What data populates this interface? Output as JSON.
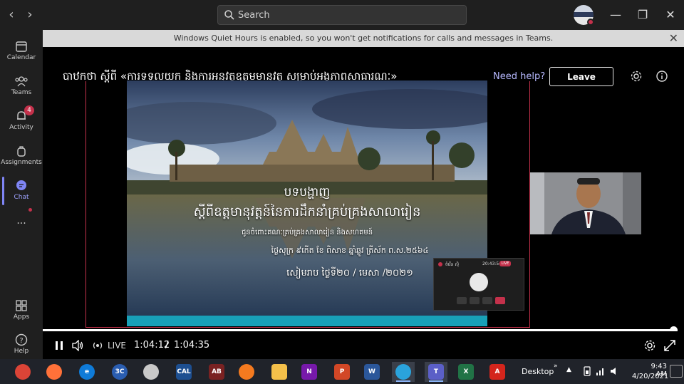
{
  "search": {
    "placeholder": "Search"
  },
  "rail": {
    "items": [
      {
        "label": "Calendar"
      },
      {
        "label": "Teams"
      },
      {
        "label": "Activity",
        "badge": "4"
      },
      {
        "label": "Assignments"
      },
      {
        "label": "Chat"
      },
      {
        "label": "..."
      },
      {
        "label": "Apps"
      },
      {
        "label": "Help"
      }
    ]
  },
  "banner": {
    "text": "Windows Quiet Hours is enabled, so you won't get notifications for calls and messages in Teams."
  },
  "meeting": {
    "title": "បាឋកថា ស្ដីពី «ការទទួលយក និងការអនុវត្តឧត្តមមានុវត្ត សម្រាប់អង្គភាពសាធារណៈ»",
    "help_label": "Need help?",
    "leave_label": "Leave"
  },
  "slide": {
    "heading": "បទបង្ហាញ",
    "subtitle": "ស្ដីពីឧត្តមានុវត្តន៍នៃការដឹកនាំគ្រប់គ្រងសាលារៀន",
    "line1": "ជូនចំពោះគណៈគ្រប់គ្រងសាលារៀន និងសហគមន៍",
    "line2": "ថ្ងៃសុក្រ ៩កើត ខែ ពិសាខ ឆ្នាំឆ្លូវ ត្រីស័ក ព.ស.២៥៦៤",
    "line3": "សៀមរាប ថ្ងៃទី២០ / មេសា /២០២១"
  },
  "mini_call": {
    "name": "ចំរើន ស៊ិ",
    "time": "20:43:54",
    "live": "LIVE"
  },
  "playback": {
    "live_label": "LIVE",
    "current_time": "1:04:12",
    "separator": "/",
    "total_time": "1:04:35",
    "progress": 0.994
  },
  "taskbar": {
    "apps": [
      {
        "name": "chrome",
        "glyph": ""
      },
      {
        "name": "firefox",
        "glyph": ""
      },
      {
        "name": "edge",
        "glyph": "e"
      },
      {
        "name": "3c",
        "glyph": "3C"
      },
      {
        "name": "seal",
        "glyph": ""
      },
      {
        "name": "cal",
        "glyph": "CAL"
      },
      {
        "name": "app-ab",
        "glyph": "AB"
      },
      {
        "name": "app-orange",
        "glyph": ""
      },
      {
        "name": "explorer",
        "glyph": ""
      },
      {
        "name": "onenote",
        "glyph": "N"
      },
      {
        "name": "powerpoint",
        "glyph": "P"
      },
      {
        "name": "word",
        "glyph": "W"
      },
      {
        "name": "telegram",
        "glyph": ""
      },
      {
        "name": "teams",
        "glyph": "T"
      },
      {
        "name": "excel",
        "glyph": "X"
      },
      {
        "name": "acrobat",
        "glyph": "A"
      }
    ],
    "desktop_label": "Desktop",
    "chevron": "»",
    "tray_up": "▲",
    "clock_time": "9:43 AM",
    "clock_date": "4/20/2021"
  },
  "colors": {
    "accent": "#7f85f5",
    "alert": "#c4314b",
    "chrome": "#1f1f1f",
    "banner": "#d9d9d9"
  }
}
